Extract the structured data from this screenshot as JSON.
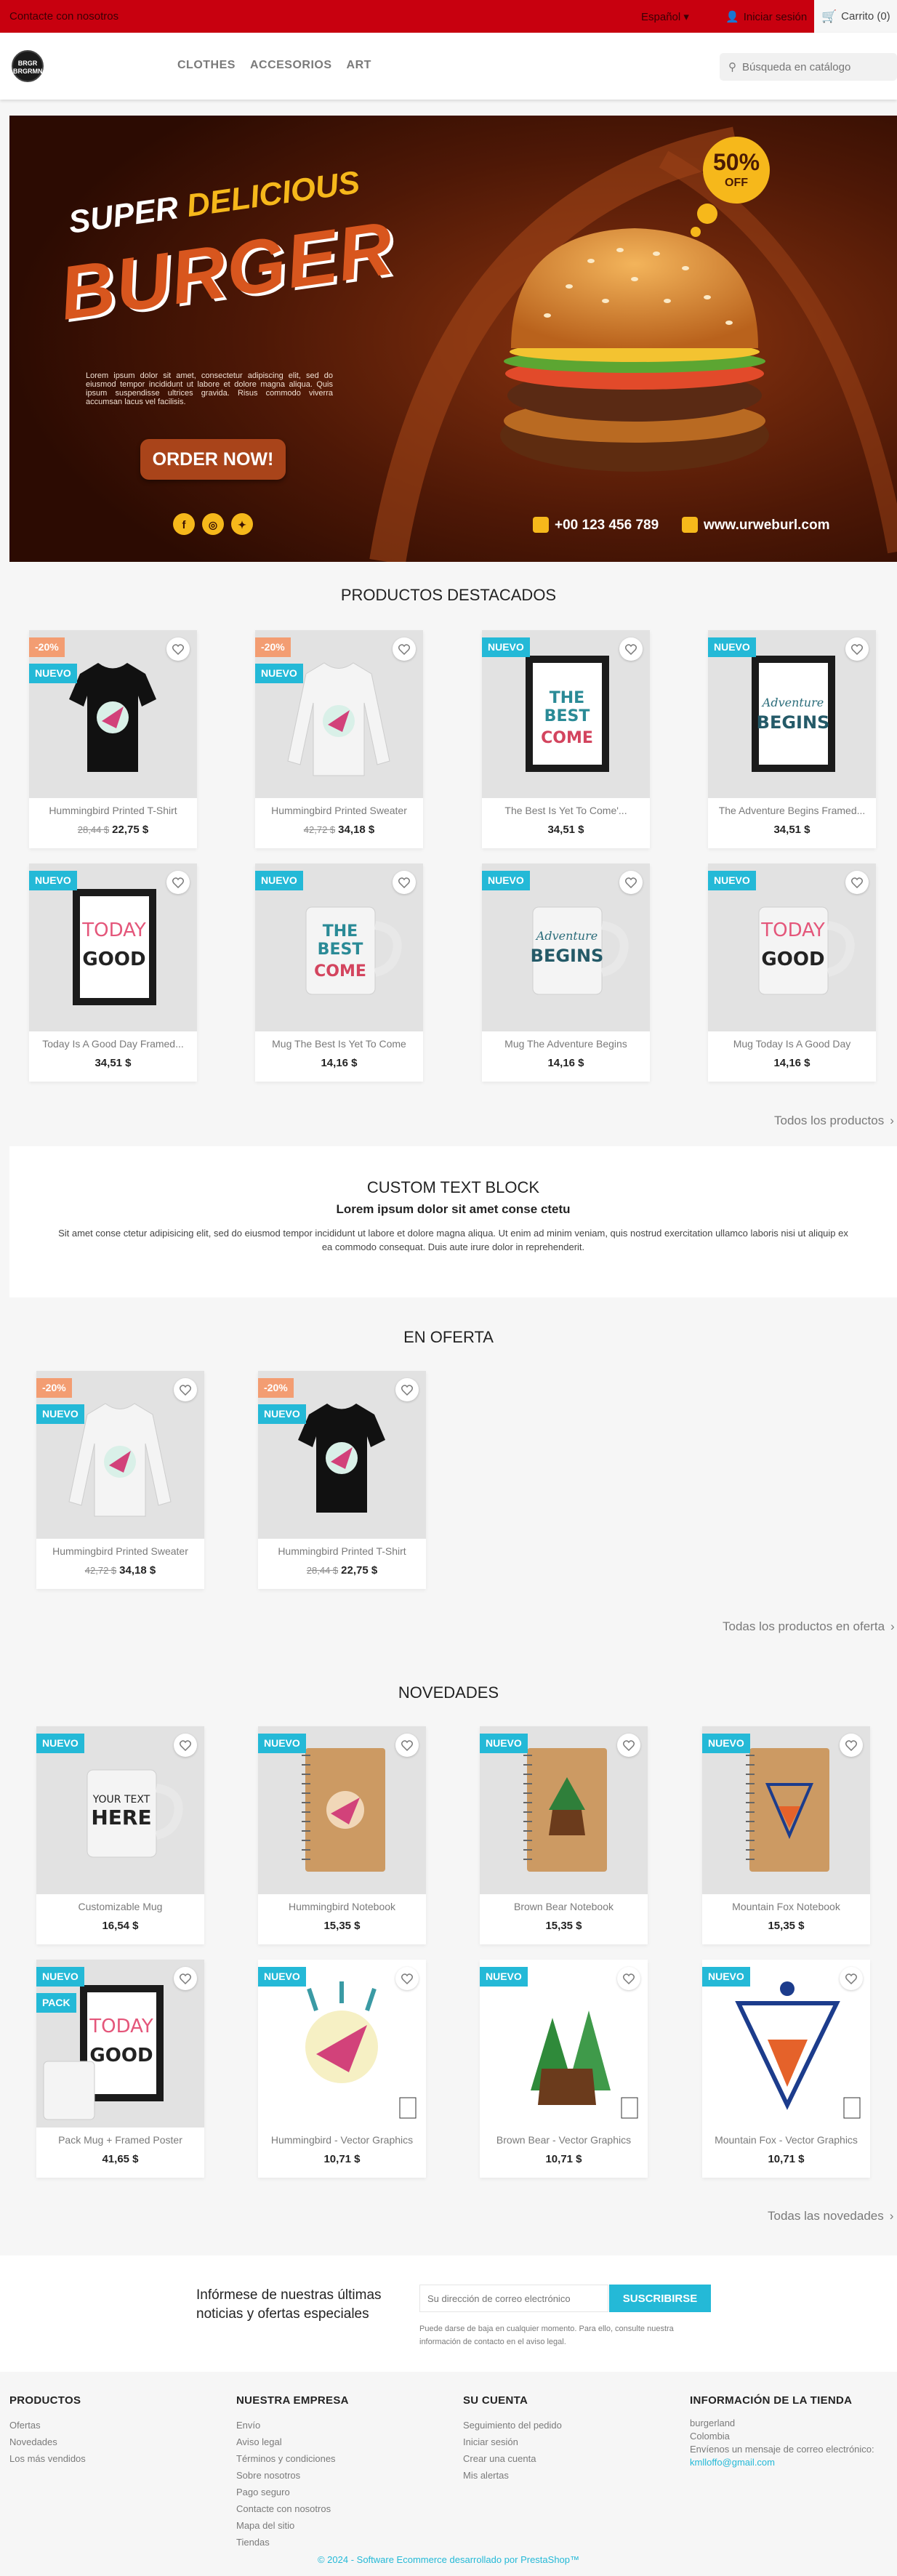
{
  "topbar": {
    "contact": "Contacte con nosotros",
    "language": "Español",
    "login": "Iniciar sesión",
    "cart": "Carrito (0)"
  },
  "header": {
    "logo_text": "BRGR BRGRMN",
    "nav": [
      "CLOTHES",
      "ACCESORIOS",
      "ART"
    ],
    "search_placeholder": "Búsqueda en catálogo"
  },
  "banner": {
    "line1": "SUPER",
    "line2": "DELICIOUS",
    "line3": "BURGER",
    "discount_value": "50%",
    "discount_label": "OFF",
    "body": "Lorem ipsum dolor sit amet, consectetur adipiscing elit, sed do eiusmod tempor incididunt ut labore et dolore magna aliqua. Quis ipsum suspendisse ultrices gravida. Risus commodo viverra accumsan lacus vel facilisis.",
    "cta": "ORDER NOW!",
    "phone": "+00 123 456 789",
    "website": "www.urweburl.com"
  },
  "featured": {
    "title": "PRODUCTOS DESTACADOS",
    "products": [
      {
        "name": "Hummingbird Printed T-Shirt",
        "old_price": "28,44 $",
        "price": "22,75 $",
        "flags": [
          "-20%",
          "NUEVO"
        ]
      },
      {
        "name": "Hummingbird Printed Sweater",
        "old_price": "42,72 $",
        "price": "34,18 $",
        "flags": [
          "-20%",
          "NUEVO"
        ]
      },
      {
        "name": "The Best Is Yet To Come'...",
        "old_price": "",
        "price": "34,51 $",
        "flags": [
          "NUEVO"
        ]
      },
      {
        "name": "The Adventure Begins Framed...",
        "old_price": "",
        "price": "34,51 $",
        "flags": [
          "NUEVO"
        ]
      },
      {
        "name": "Today Is A Good Day Framed...",
        "old_price": "",
        "price": "34,51 $",
        "flags": [
          "NUEVO"
        ]
      },
      {
        "name": "Mug The Best Is Yet To Come",
        "old_price": "",
        "price": "14,16 $",
        "flags": [
          "NUEVO"
        ]
      },
      {
        "name": "Mug The Adventure Begins",
        "old_price": "",
        "price": "14,16 $",
        "flags": [
          "NUEVO"
        ]
      },
      {
        "name": "Mug Today Is A Good Day",
        "old_price": "",
        "price": "14,16 $",
        "flags": [
          "NUEVO"
        ]
      }
    ],
    "all_link": "Todos los productos"
  },
  "custom_block": {
    "title": "CUSTOM TEXT BLOCK",
    "subtitle": "Lorem ipsum dolor sit amet conse ctetu",
    "body": "Sit amet conse ctetur adipisicing elit, sed do eiusmod tempor incididunt ut labore et dolore magna aliqua. Ut enim ad minim veniam, quis nostrud exercitation ullamco laboris nisi ut aliquip ex ea commodo consequat. Duis aute irure dolor in reprehenderit."
  },
  "sale": {
    "title": "EN OFERTA",
    "products": [
      {
        "name": "Hummingbird Printed Sweater",
        "old_price": "42,72 $",
        "price": "34,18 $",
        "flags": [
          "-20%",
          "NUEVO"
        ]
      },
      {
        "name": "Hummingbird Printed T-Shirt",
        "old_price": "28,44 $",
        "price": "22,75 $",
        "flags": [
          "-20%",
          "NUEVO"
        ]
      }
    ],
    "all_link": "Todas los productos en oferta"
  },
  "new_products": {
    "title": "NOVEDADES",
    "products": [
      {
        "name": "Customizable Mug",
        "old_price": "",
        "price": "16,54 $",
        "flags": [
          "NUEVO"
        ]
      },
      {
        "name": "Hummingbird Notebook",
        "old_price": "",
        "price": "15,35 $",
        "flags": [
          "NUEVO"
        ]
      },
      {
        "name": "Brown Bear Notebook",
        "old_price": "",
        "price": "15,35 $",
        "flags": [
          "NUEVO"
        ]
      },
      {
        "name": "Mountain Fox Notebook",
        "old_price": "",
        "price": "15,35 $",
        "flags": [
          "NUEVO"
        ]
      },
      {
        "name": "Pack Mug + Framed Poster",
        "old_price": "",
        "price": "41,65 $",
        "flags": [
          "NUEVO",
          "PACK"
        ]
      },
      {
        "name": "Hummingbird - Vector Graphics",
        "old_price": "",
        "price": "10,71 $",
        "flags": [
          "NUEVO"
        ]
      },
      {
        "name": "Brown Bear - Vector Graphics",
        "old_price": "",
        "price": "10,71 $",
        "flags": [
          "NUEVO"
        ]
      },
      {
        "name": "Mountain Fox - Vector Graphics",
        "old_price": "",
        "price": "10,71 $",
        "flags": [
          "NUEVO"
        ]
      }
    ],
    "all_link": "Todas las novedades"
  },
  "newsletter": {
    "text": "Infórmese de nuestras últimas noticias y ofertas especiales",
    "placeholder": "Su dirección de correo electrónico",
    "button": "SUSCRIBIRSE",
    "note": "Puede darse de baja en cualquier momento. Para ello, consulte nuestra información de contacto en el aviso legal."
  },
  "footer": {
    "products": {
      "title": "PRODUCTOS",
      "links": [
        "Ofertas",
        "Novedades",
        "Los más vendidos"
      ]
    },
    "company": {
      "title": "NUESTRA EMPRESA",
      "links": [
        "Envío",
        "Aviso legal",
        "Términos y condiciones",
        "Sobre nosotros",
        "Pago seguro",
        "Contacte con nosotros",
        "Mapa del sitio",
        "Tiendas"
      ]
    },
    "account": {
      "title": "SU CUENTA",
      "links": [
        "Seguimiento del pedido",
        "Iniciar sesión",
        "Crear una cuenta",
        "Mis alertas"
      ]
    },
    "store": {
      "title": "INFORMACIÓN DE LA TIENDA",
      "lines": [
        "burgerland",
        "Colombia",
        "Envíenos un mensaje de correo electrónico:"
      ],
      "email": "kmlloffo@gmail.com"
    },
    "copyright": "© 2024 - Software Ecommerce desarrollado por PrestaShop™"
  },
  "colors": {
    "accent": "#24b9d7",
    "topbar": "#c8000f",
    "discount": "#f39d72"
  }
}
